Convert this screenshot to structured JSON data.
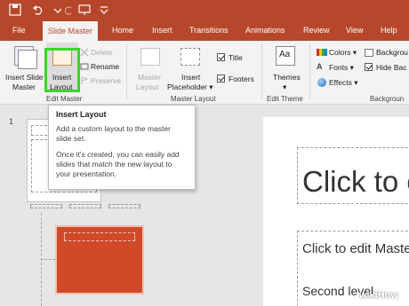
{
  "tabs": [
    "File",
    "Slide Master",
    "Home",
    "Insert",
    "Transitions",
    "Animations",
    "Review",
    "View",
    "Help"
  ],
  "active_tab": "Slide Master",
  "ribbon": {
    "insert_slide_master": [
      "Insert Slide",
      "Master"
    ],
    "insert_layout": [
      "Insert",
      "Layout"
    ],
    "delete": "Delete",
    "rename": "Rename",
    "preserve": "Preserve",
    "master_layout": [
      "Master",
      "Layout"
    ],
    "insert_placeholder": [
      "Insert",
      "Placeholder ▾"
    ],
    "title": "Title",
    "footers": "Footers",
    "themes": [
      "Themes",
      "▾"
    ],
    "colors": "Colors ▾",
    "fonts": "Fonts ▾",
    "effects": "Effects ▾",
    "background_styles": "Backgrou",
    "hide_background": "Hide Bac",
    "groups": {
      "edit_master": "Edit Master",
      "master_layout": "Master Layout",
      "edit_theme": "Edit Theme",
      "background": "Backgroun"
    },
    "theme_preview": "Aa"
  },
  "tooltip": {
    "title": "Insert Layout",
    "para1": "Add a custom layout to the master slide set.",
    "para2": "Once it's created, you can easily add slides that match the new layout to your presentation."
  },
  "thumbnails": {
    "slide_number": "1"
  },
  "slide": {
    "title": "Click to e",
    "body1": "Click to edit Master",
    "body2": "Second level"
  },
  "watermark": "wikiHow",
  "colors": {
    "accent": "#b7472a",
    "highlight": "#3ad52a"
  }
}
